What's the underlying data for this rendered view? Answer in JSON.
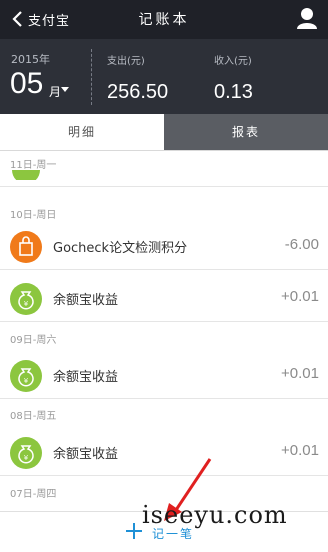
{
  "nav": {
    "back_label": "支付宝",
    "title": "记账本"
  },
  "summary": {
    "year": "2015年",
    "month": "05",
    "month_suffix": "月",
    "expense_label": "支出(元)",
    "expense_value": "256.50",
    "income_label": "收入(元)",
    "income_value": "0.13"
  },
  "tabs": {
    "detail": "明细",
    "report": "报表"
  },
  "list": {
    "headers": [
      "11日-周一",
      "10日-周日",
      "09日-周六",
      "08日-周五",
      "07日-周四"
    ],
    "rows": [
      {
        "label": "Gocheck论文检测积分",
        "amount": "-6.00",
        "icon": "shopping-bag-icon"
      },
      {
        "label": "余额宝收益",
        "amount": "+0.01",
        "icon": "money-bag-icon"
      },
      {
        "label": "余额宝收益",
        "amount": "+0.01",
        "icon": "money-bag-icon"
      },
      {
        "label": "余额宝收益",
        "amount": "+0.01",
        "icon": "money-bag-icon"
      }
    ]
  },
  "bottom": {
    "add_label": "记一笔"
  },
  "watermark": "iseeyu.com",
  "colors": {
    "nav_bg": "#1f2128",
    "summary_bg": "#2d3038",
    "orange": "#f07a1a",
    "green": "#8cc63f",
    "accent": "#1e90d6"
  }
}
